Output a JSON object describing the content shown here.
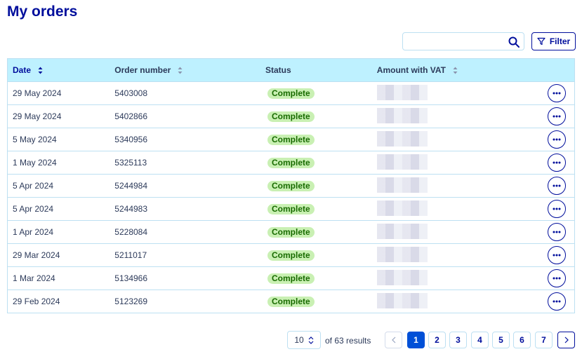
{
  "page": {
    "title": "My orders"
  },
  "toolbar": {
    "search_placeholder": "",
    "search_value": "",
    "filter_label": "Filter"
  },
  "table": {
    "headers": {
      "date": "Date",
      "order_number": "Order number",
      "status": "Status",
      "amount": "Amount with VAT"
    },
    "rows": [
      {
        "date": "29 May 2024",
        "order_number": "5403008",
        "status": "Complete"
      },
      {
        "date": "29 May 2024",
        "order_number": "5402866",
        "status": "Complete"
      },
      {
        "date": "5 May 2024",
        "order_number": "5340956",
        "status": "Complete"
      },
      {
        "date": "1 May 2024",
        "order_number": "5325113",
        "status": "Complete"
      },
      {
        "date": "5 Apr 2024",
        "order_number": "5244984",
        "status": "Complete"
      },
      {
        "date": "5 Apr 2024",
        "order_number": "5244983",
        "status": "Complete"
      },
      {
        "date": "1 Apr 2024",
        "order_number": "5228084",
        "status": "Complete"
      },
      {
        "date": "29 Mar 2024",
        "order_number": "5211017",
        "status": "Complete"
      },
      {
        "date": "1 Mar 2024",
        "order_number": "5134966",
        "status": "Complete"
      },
      {
        "date": "29 Feb 2024",
        "order_number": "5123269",
        "status": "Complete"
      }
    ]
  },
  "pagination": {
    "page_size": "10",
    "results_text": "of 63 results",
    "pages": [
      "1",
      "2",
      "3",
      "4",
      "5",
      "6",
      "7"
    ],
    "current_page": "1"
  },
  "colors": {
    "brand": "#000e9c",
    "header_bg": "#bef1ff",
    "row_border": "#bde0f2",
    "status_bg": "#c9f0b3",
    "status_text": "#196c01",
    "active_page": "#0050d7"
  }
}
